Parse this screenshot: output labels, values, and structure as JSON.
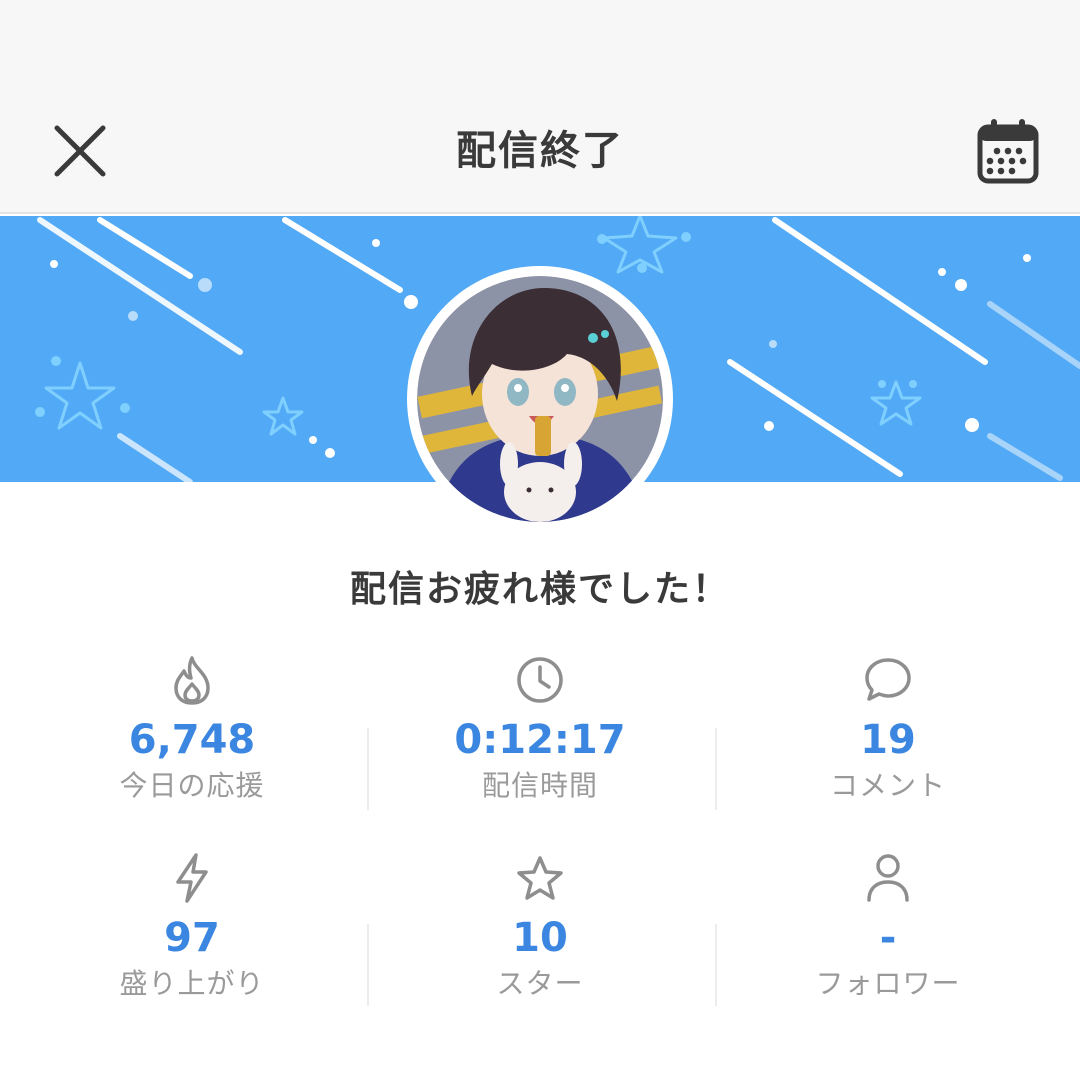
{
  "header": {
    "title": "配信終了",
    "close_icon": "close-icon",
    "calendar_icon": "calendar-icon"
  },
  "banner": {
    "background_color": "#52a9f5"
  },
  "greeting": "配信お疲れ様でした！",
  "stats": [
    {
      "icon": "flame-icon",
      "value": "6,748",
      "label": "今日の応援"
    },
    {
      "icon": "clock-icon",
      "value": "0:12:17",
      "label": "配信時間"
    },
    {
      "icon": "comment-icon",
      "value": "19",
      "label": "コメント"
    },
    {
      "icon": "lightning-icon",
      "value": "97",
      "label": "盛り上がり"
    },
    {
      "icon": "star-icon",
      "value": "10",
      "label": "スター"
    },
    {
      "icon": "person-icon",
      "value": "-",
      "label": "フォロワー"
    }
  ],
  "colors": {
    "accent": "#3b86e0",
    "label_gray": "#9a9a9a",
    "title_text": "#3a3a3a"
  }
}
